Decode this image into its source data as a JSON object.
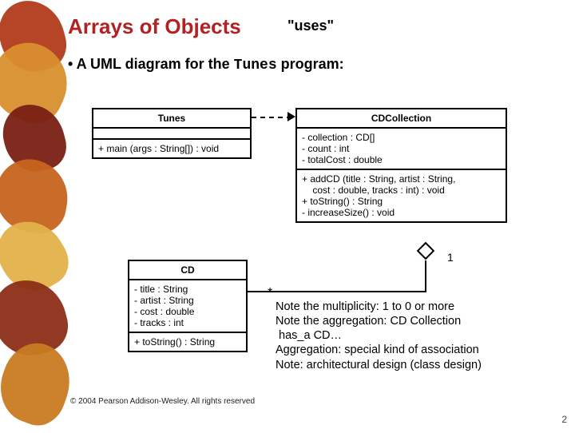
{
  "title": "Arrays of Objects",
  "uses_label": "\"uses\"",
  "bullet_prefix": "•  A UML diagram for the ",
  "bullet_code": "Tunes",
  "bullet_suffix": " program:",
  "tunes": {
    "name": "Tunes",
    "op1": "+ main (args : String[]) : void"
  },
  "cdcollection": {
    "name": "CDCollection",
    "attr1": "- collection : CD[]",
    "attr2": "- count : int",
    "attr3": "- totalCost : double",
    "op1": "+ addCD (title : String, artist : String,",
    "op1b": "    cost : double, tracks : int) : void",
    "op2": "+ toString() : String",
    "op3": "- increaseSize() : void"
  },
  "cd": {
    "name": "CD",
    "attr1": "- title : String",
    "attr2": "- artist : String",
    "attr3": "- cost : double",
    "attr4": "- tracks : int",
    "op1": "+ toString() : String"
  },
  "mult_one": "1",
  "mult_star": "*",
  "notes": {
    "l1": "Note the multiplicity:  1 to 0 or more",
    "l2": "Note the aggregation:  CD Collection",
    "l3": " has_a CD…",
    "l4": "Aggregation:  special kind of association",
    "l5": "Note:  architectural design (class design)"
  },
  "copyright": "© 2004 Pearson Addison-Wesley. All rights reserved",
  "page": "2"
}
